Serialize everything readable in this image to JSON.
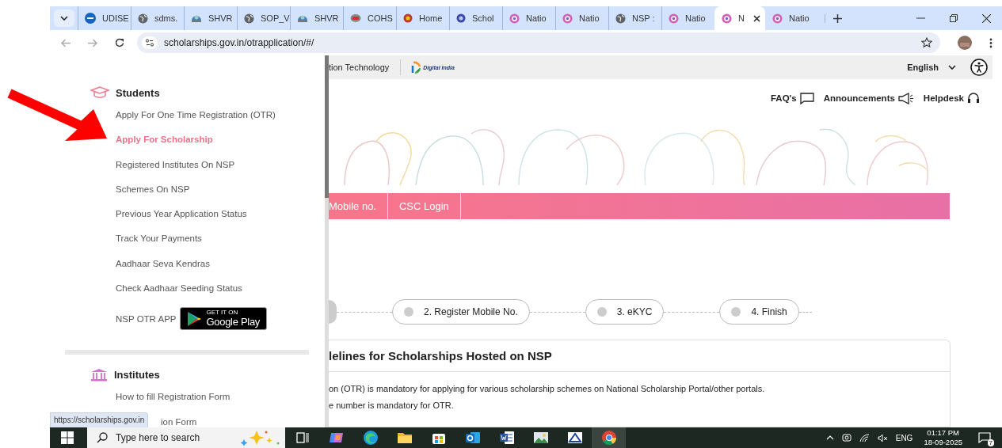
{
  "browser": {
    "tabs": [
      {
        "label": "UDISE",
        "selected": false
      },
      {
        "label": "sdms.",
        "selected": false
      },
      {
        "label": "SHVR",
        "selected": false
      },
      {
        "label": "SOP_V",
        "selected": false
      },
      {
        "label": "SHVR",
        "selected": false
      },
      {
        "label": "COHS",
        "selected": false
      },
      {
        "label": "Home",
        "selected": false
      },
      {
        "label": "Schol",
        "selected": false
      },
      {
        "label": "Natio",
        "selected": false
      },
      {
        "label": "Natio",
        "selected": false
      },
      {
        "label": "NSP :",
        "selected": false
      },
      {
        "label": "Natio",
        "selected": false
      },
      {
        "label": "N",
        "selected": true
      },
      {
        "label": "Natio",
        "selected": false
      }
    ],
    "address": "scholarships.gov.in/otrapplication/#/",
    "status_url": "https://scholarships.gov.in"
  },
  "header": {
    "department_fragment": "tion Technology",
    "logo_text": "Digital India",
    "language": "English"
  },
  "links": [
    "FAQ's",
    "Announcements",
    "Helpdesk"
  ],
  "nav": [
    "Mobile no.",
    "CSC Login"
  ],
  "steps": [
    "2. Register Mobile No.",
    "3. eKYC",
    "4. Finish"
  ],
  "card": {
    "title": "lelines for Scholarships Hosted on NSP",
    "lines": [
      "on (OTR) is mandatory for applying for various scholarship schemes on National Scholarship Portal/other portals.",
      "e number is mandatory for OTR."
    ]
  },
  "sidebar": {
    "sections": [
      {
        "title": "Students",
        "items": [
          {
            "label": "Apply For One Time Registration (OTR)",
            "selected": false
          },
          {
            "label": "Apply For Scholarship",
            "selected": true
          },
          {
            "label": "Registered Institutes On NSP",
            "selected": false
          },
          {
            "label": "Schemes On NSP",
            "selected": false
          },
          {
            "label": "Previous Year Application Status",
            "selected": false
          },
          {
            "label": "Track Your Payments",
            "selected": false
          },
          {
            "label": "Aadhaar Seva Kendras",
            "selected": false
          },
          {
            "label": "Check Aadhaar Seeding Status",
            "selected": false
          }
        ],
        "app": {
          "label": "NSP OTR APP",
          "badge_top": "GET IT ON",
          "badge_main": "Google Play"
        }
      },
      {
        "title": "Institutes",
        "items": [
          {
            "label": "How to fill Registration Form",
            "selected": false
          },
          {
            "label": "ion Form",
            "selected": false
          }
        ]
      }
    ]
  },
  "taskbar": {
    "search_placeholder": "Type here to search",
    "apps": [
      {
        "selected": false
      },
      {
        "selected": false
      },
      {
        "selected": false
      },
      {
        "selected": false
      },
      {
        "selected": false
      },
      {
        "selected": false
      },
      {
        "selected": false
      },
      {
        "selected": false
      },
      {
        "selected": false
      },
      {
        "selected": true
      }
    ],
    "language": "ENG",
    "time": "01:17 PM",
    "date": "18-09-2025",
    "notifications": "7"
  }
}
